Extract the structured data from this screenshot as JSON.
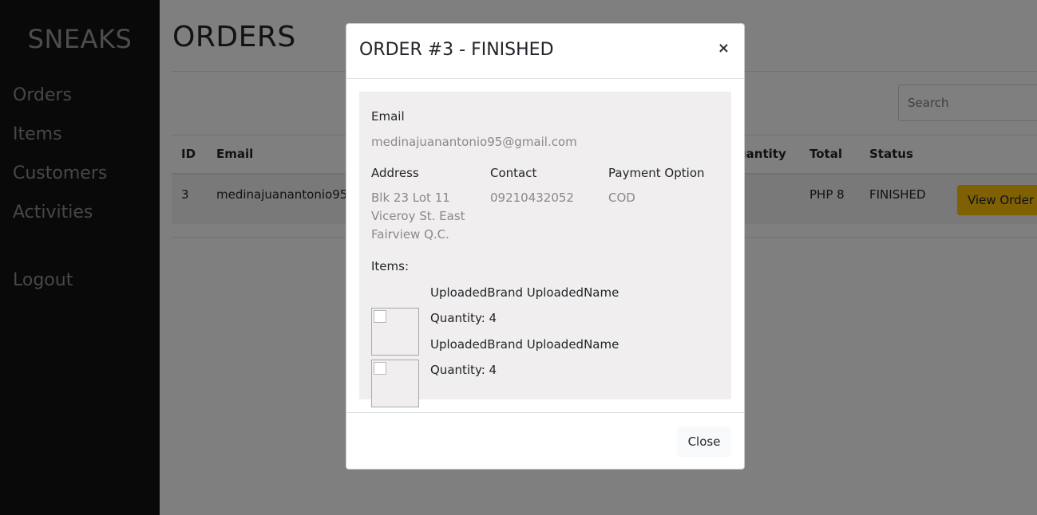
{
  "sidebar": {
    "brand": "SNEAKS",
    "items": [
      {
        "label": "Orders"
      },
      {
        "label": "Items"
      },
      {
        "label": "Customers"
      },
      {
        "label": "Activities"
      }
    ],
    "logout_label": "Logout"
  },
  "main": {
    "title": "ORDERS",
    "search_placeholder": "Search",
    "table": {
      "headers": [
        "ID",
        "Email",
        "uantity",
        "Total",
        "Status"
      ],
      "row": {
        "id": "3",
        "email": "medinajuanantonio95",
        "total": "PHP 8",
        "status": "FINISHED",
        "action_label": "View Order"
      }
    }
  },
  "modal": {
    "title": "ORDER #3 - FINISHED",
    "close_icon": "×",
    "email_label": "Email",
    "email_value": "medinajuanantonio95@gmail.com",
    "address_label": "Address",
    "address_lines": [
      "Blk 23 Lot 11",
      "Viceroy St. East",
      "Fairview Q.C."
    ],
    "contact_label": "Contact",
    "contact_value": "09210432052",
    "payment_label": "Payment Option",
    "payment_value": "COD",
    "items_label": "Items:",
    "items": [
      {
        "name": "UploadedBrand UploadedName",
        "quantity": "Quantity: 4"
      },
      {
        "name": "UploadedBrand UploadedName",
        "quantity": "Quantity: 4"
      }
    ],
    "close_label": "Close"
  },
  "colors": {
    "sidebar_bg": "#131313",
    "accent_button": "#ffc107",
    "backdrop": "rgba(0,0,0,0.5)",
    "card_bg": "#f0eeef"
  }
}
